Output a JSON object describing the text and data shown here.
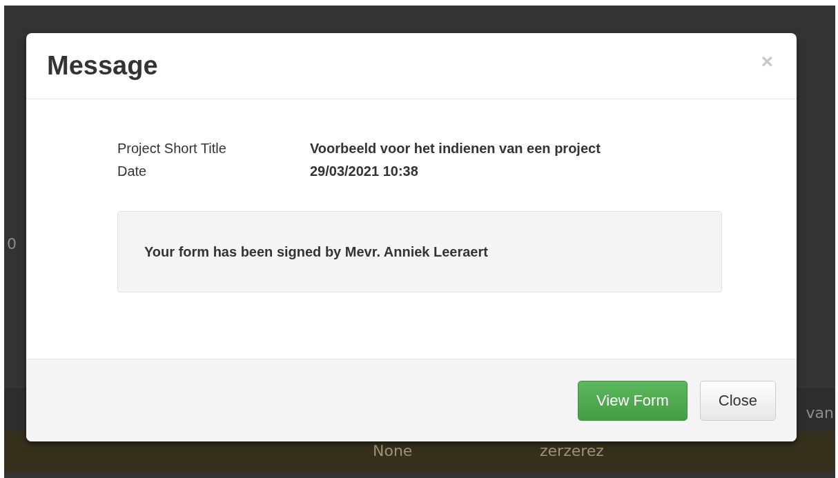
{
  "background": {
    "left_text": "0",
    "row_text": "van",
    "highlighted_row": [
      "None",
      "zerzerez"
    ]
  },
  "modal": {
    "title": "Message",
    "close_icon": "×",
    "fields": [
      {
        "label": "Project Short Title",
        "value": "Voorbeeld voor het indienen van een project"
      },
      {
        "label": "Date",
        "value": "29/03/2021 10:38"
      }
    ],
    "message": "Your form has been signed by Mevr. Anniek Leeraert",
    "buttons": [
      {
        "label": "View Form",
        "kind": "primary"
      },
      {
        "label": "Close",
        "kind": "default"
      }
    ]
  }
}
